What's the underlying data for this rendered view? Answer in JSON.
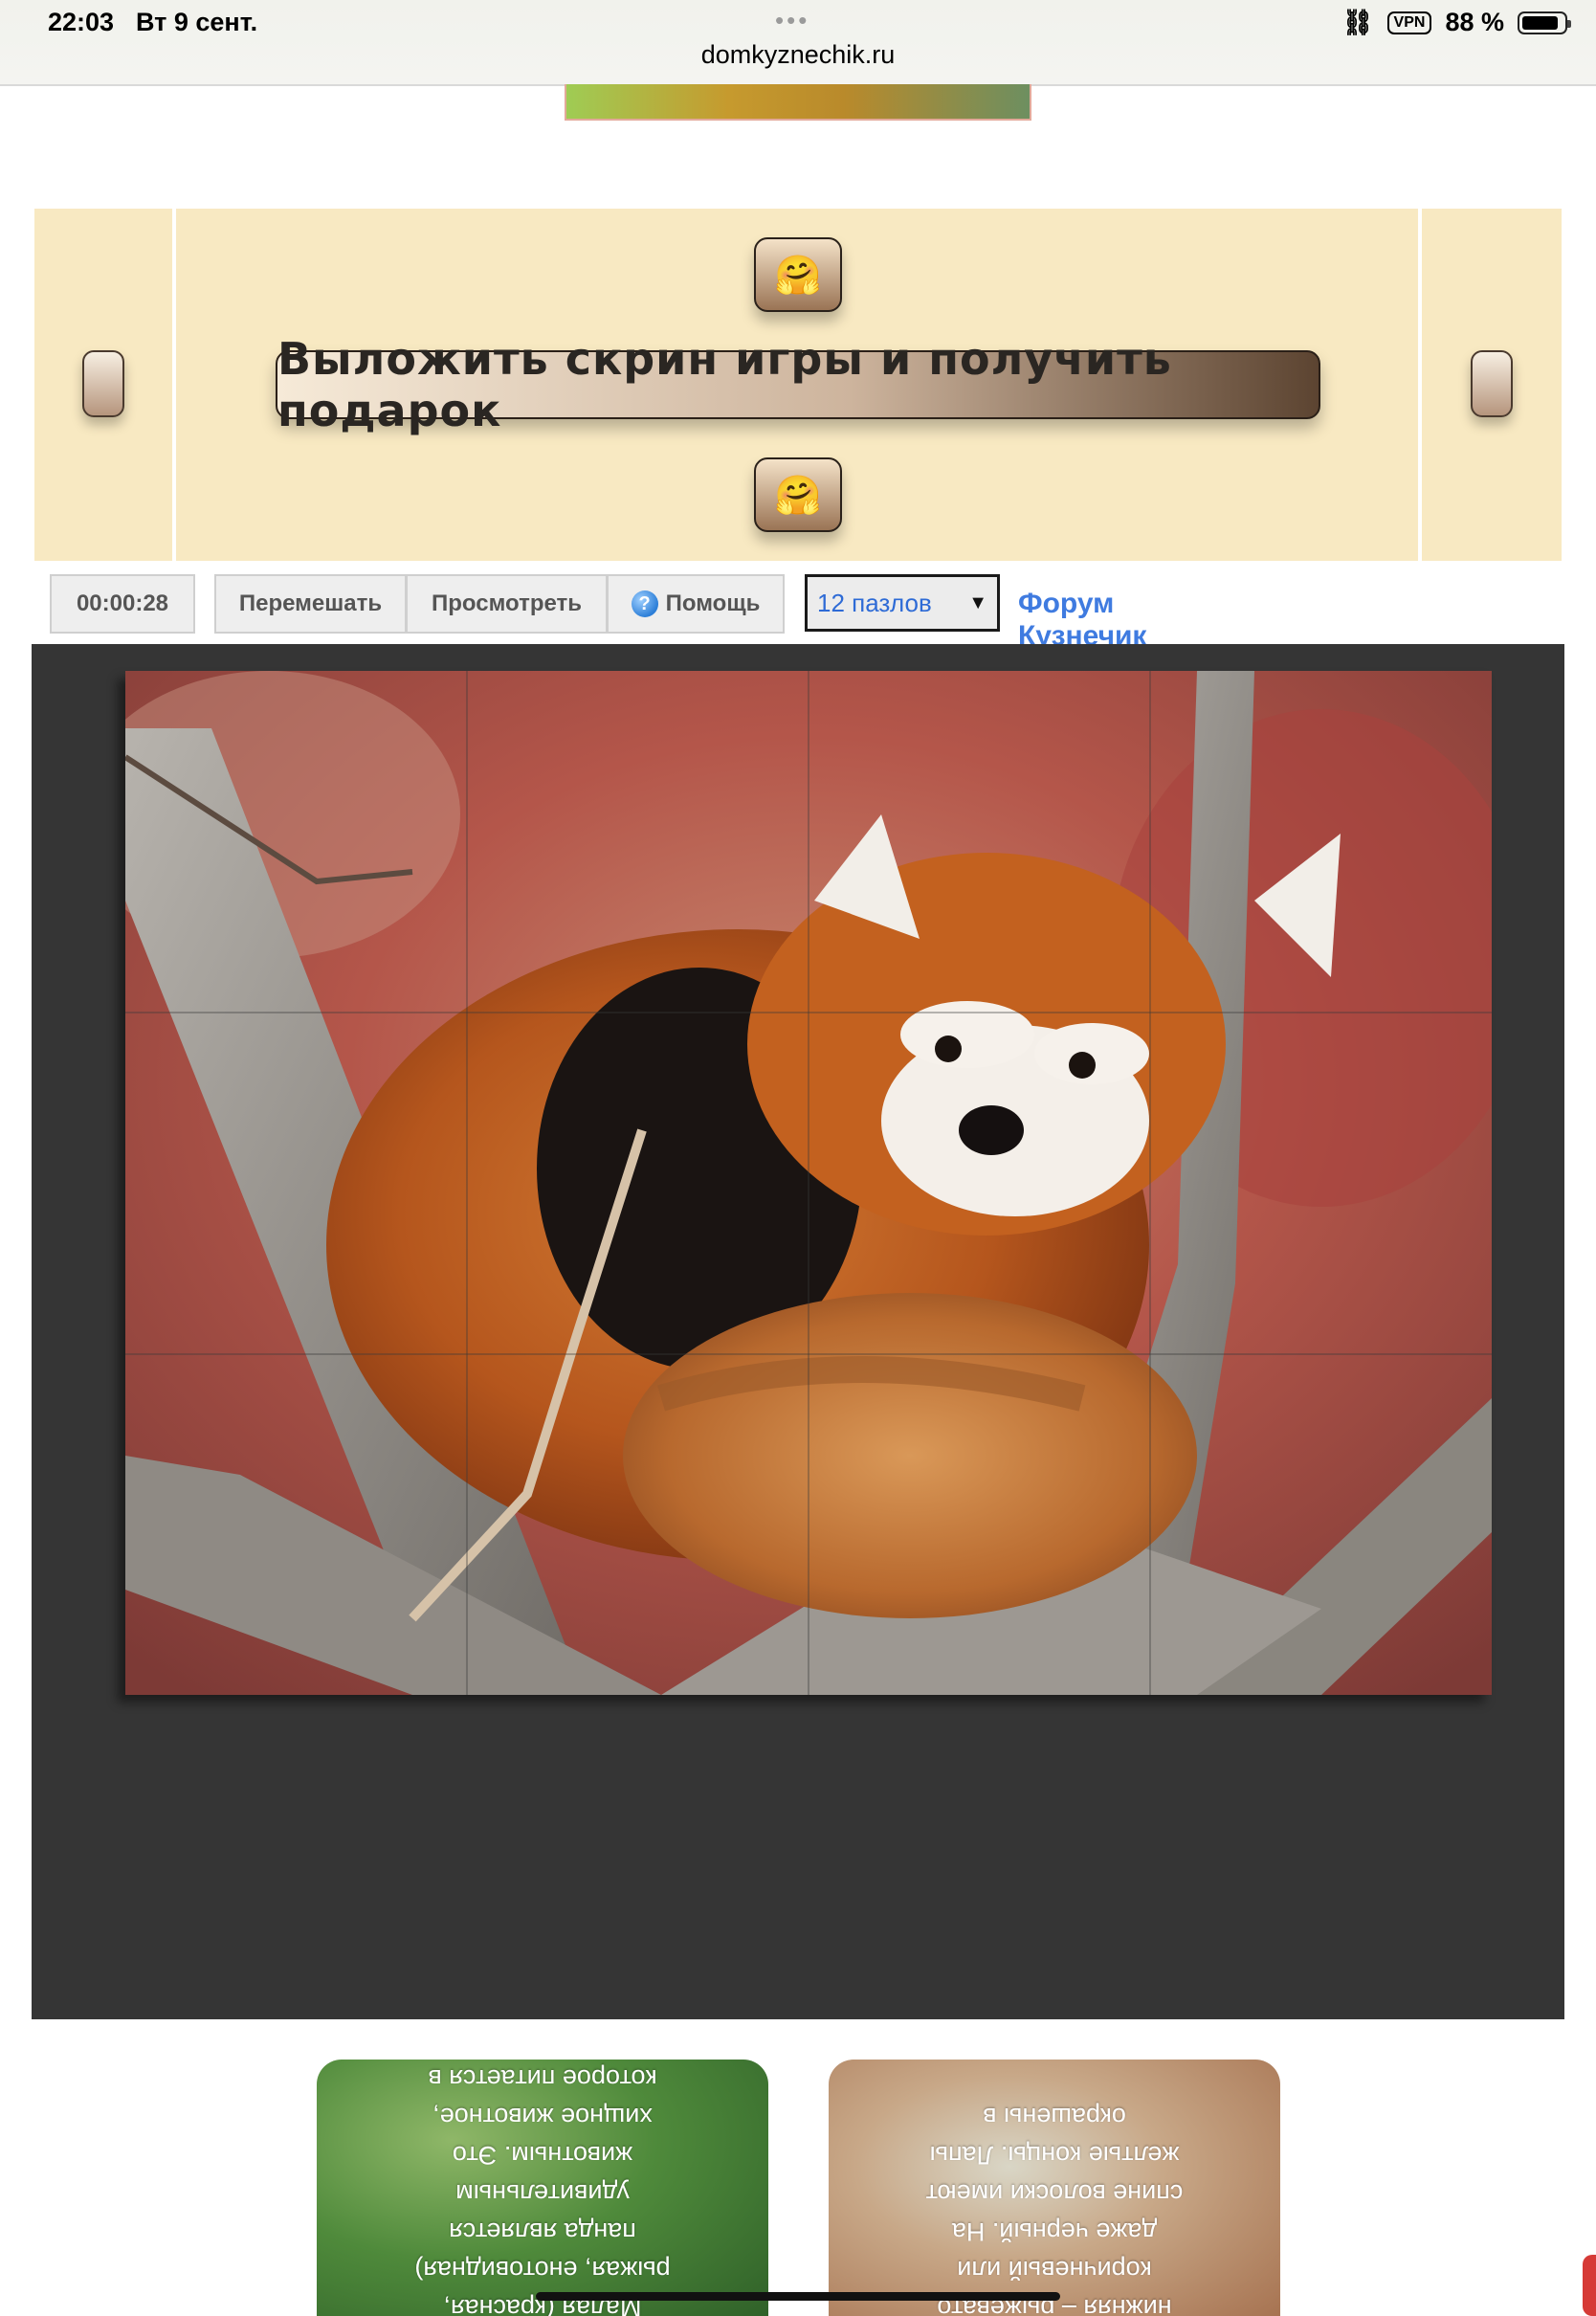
{
  "status_bar": {
    "time": "22:03",
    "date": "Вт 9 сент.",
    "dots": "•••",
    "url": "domkyznechik.ru",
    "vpn": "VPN",
    "battery": "88 %",
    "battery_level": 0.88
  },
  "promo": {
    "emoji": "🤗",
    "button_label": "Выложить скрин игры и получить подарок"
  },
  "toolbar": {
    "timer": "00:00:28",
    "shuffle": "Перемешать",
    "preview": "Просмотреть",
    "help_icon": "?",
    "help": "Помощь",
    "pieces_select": "12 пазлов",
    "forum_link": "Форум Кузнечик"
  },
  "puzzle": {
    "image": "red-panda-on-tree-branch",
    "rows": 3,
    "columns": 4,
    "pieces": 12
  },
  "cards": [
    {
      "lines": [
        "Малая (красная,",
        "рыжая, енотовидная)",
        "панда является",
        "удивительным",
        "животным. Это",
        "хищное животное,",
        "которое питается в"
      ]
    },
    {
      "lines": [
        "нижняя – рыжевато",
        "коричневый или",
        "даже черный. На",
        "спине волоски имеют",
        "желтые концы. Лапы",
        "окрашены в"
      ]
    }
  ],
  "colors": {
    "promo_bg": "#f8e9c2",
    "board_bg": "#353535",
    "link": "#3f7be0"
  }
}
